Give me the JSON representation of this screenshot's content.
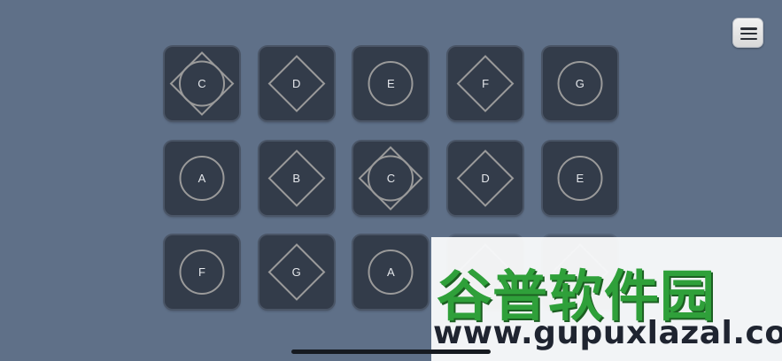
{
  "menu": {
    "icon": "hamburger-icon"
  },
  "pads": [
    {
      "label": "C",
      "shape": "circle+diamond",
      "row": 0,
      "col": 0
    },
    {
      "label": "D",
      "shape": "diamond",
      "row": 0,
      "col": 1
    },
    {
      "label": "E",
      "shape": "circle",
      "row": 0,
      "col": 2
    },
    {
      "label": "F",
      "shape": "diamond",
      "row": 0,
      "col": 3
    },
    {
      "label": "G",
      "shape": "circle",
      "row": 0,
      "col": 4
    },
    {
      "label": "A",
      "shape": "circle",
      "row": 1,
      "col": 0
    },
    {
      "label": "B",
      "shape": "diamond",
      "row": 1,
      "col": 1
    },
    {
      "label": "C",
      "shape": "circle+diamond",
      "row": 1,
      "col": 2
    },
    {
      "label": "D",
      "shape": "diamond",
      "row": 1,
      "col": 3
    },
    {
      "label": "E",
      "shape": "circle",
      "row": 1,
      "col": 4
    },
    {
      "label": "F",
      "shape": "circle",
      "row": 2,
      "col": 0
    },
    {
      "label": "G",
      "shape": "diamond",
      "row": 2,
      "col": 1
    },
    {
      "label": "A",
      "shape": "circle",
      "row": 2,
      "col": 2
    },
    {
      "label": "",
      "shape": "diamond",
      "row": 2,
      "col": 3
    },
    {
      "label": "",
      "shape": "diamond",
      "row": 2,
      "col": 4
    }
  ],
  "watermark": {
    "title": "谷普软件园",
    "url": "www.gupuxlazal.com"
  },
  "colors": {
    "background": "#5f7088",
    "pad": "#333c4a",
    "shape_stroke": "#9a9a9a",
    "watermark_green": "#2fa03a"
  }
}
